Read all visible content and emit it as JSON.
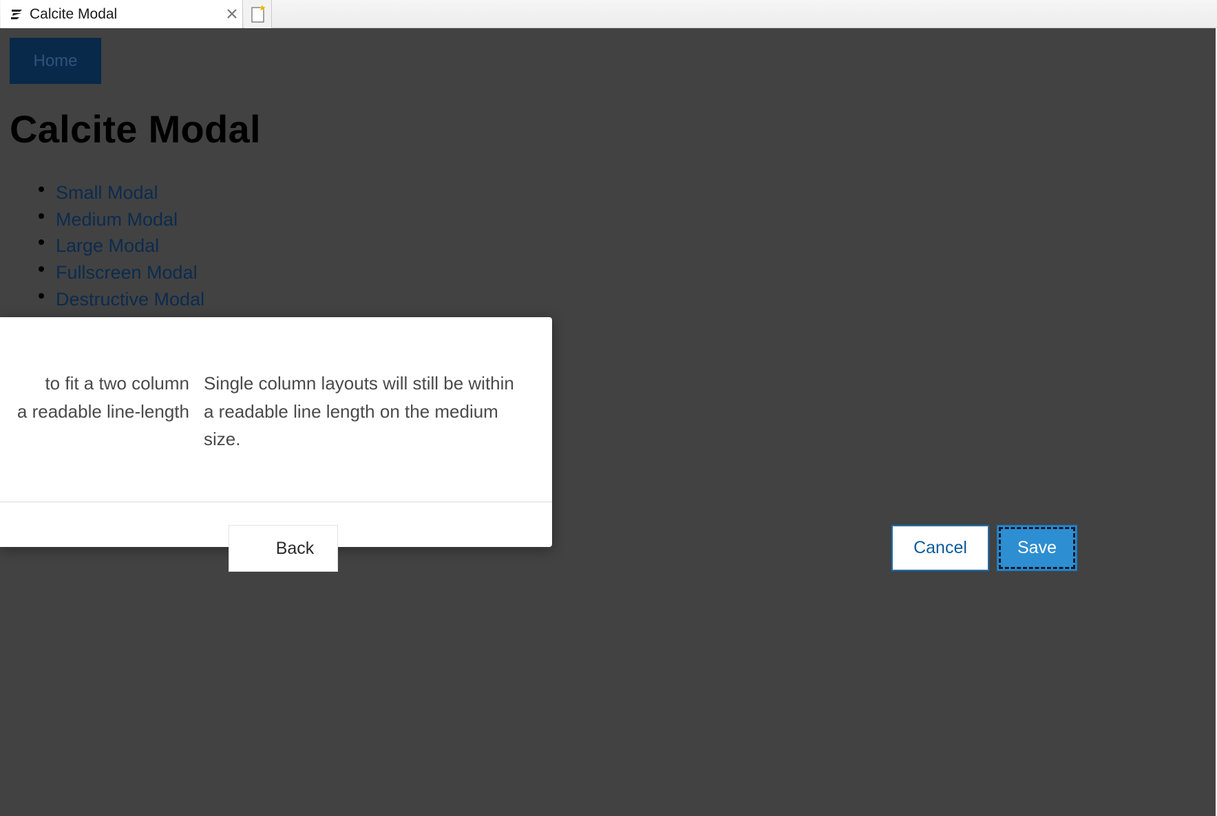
{
  "browser": {
    "tab_title": "Calcite Modal",
    "tab_icon": "calcite-logo-icon",
    "close_icon": "close-icon",
    "new_tab_icon": "new-tab-icon"
  },
  "page": {
    "home_label": "Home",
    "title": "Calcite Modal",
    "links": [
      "Small Modal",
      "Medium Modal",
      "Large Modal",
      "Fullscreen Modal",
      "Destructive Modal"
    ]
  },
  "modal": {
    "left_column_lines": [
      "to fit a two column",
      "a readable line-length"
    ],
    "right_column_text": "Single column layouts will still be within a readable line length on the medium size.",
    "back_label": "Back",
    "cancel_label": "Cancel",
    "save_label": "Save"
  },
  "colors": {
    "backdrop": "#424242",
    "home_button": "#08294a",
    "link": "#0b2b4f",
    "primary": "#2e8ed2",
    "secondary_border": "#1c70b0"
  }
}
